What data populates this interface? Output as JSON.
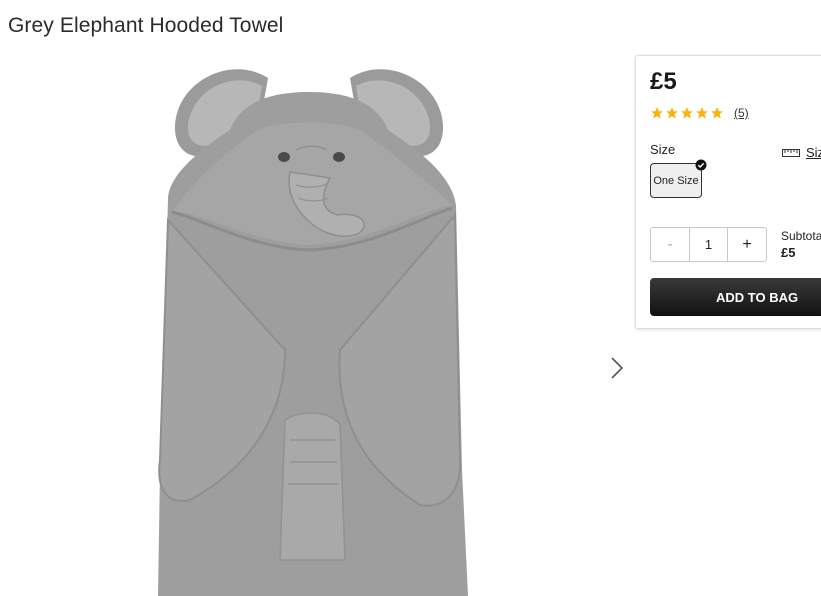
{
  "product": {
    "title": "Grey Elephant Hooded Towel",
    "image_alt": "Grey elephant hooded towel"
  },
  "purchase_panel": {
    "price": "£5",
    "rating": 5,
    "review_count": "(5)",
    "size_label": "Size",
    "size_guide_label": "Size",
    "selected_size": "One Size",
    "quantity": "1",
    "minus_label": "-",
    "plus_label": "+",
    "subtotal_label": "Subtotal",
    "subtotal_value": "£5",
    "add_to_bag_label": "ADD TO BAG"
  },
  "icons": {
    "star": "star-icon",
    "next": "chevron-right-icon",
    "ruler": "ruler-icon",
    "check": "check-circle-icon"
  },
  "colors": {
    "star": "#f5b50a",
    "button_dark": "#1a1a1a",
    "towel_grey": "#9c9c9c"
  }
}
